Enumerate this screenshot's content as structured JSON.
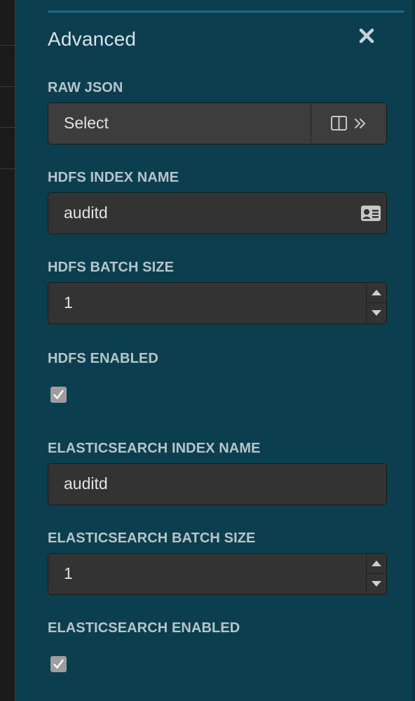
{
  "panel": {
    "title": "Advanced"
  },
  "fields": {
    "raw_json": {
      "label": "RAW JSON",
      "value": "Select"
    },
    "hdfs_index_name": {
      "label": "HDFS INDEX NAME",
      "value": "auditd"
    },
    "hdfs_batch_size": {
      "label": "HDFS BATCH SIZE",
      "value": "1"
    },
    "hdfs_enabled": {
      "label": "HDFS ENABLED",
      "checked": true
    },
    "es_index_name": {
      "label": "ELASTICSEARCH INDEX NAME",
      "value": "auditd"
    },
    "es_batch_size": {
      "label": "ELASTICSEARCH BATCH SIZE",
      "value": "1"
    },
    "es_enabled": {
      "label": "ELASTICSEARCH ENABLED",
      "checked": true
    }
  },
  "icons": {
    "close": "close-icon",
    "split_view": "split-view-icon",
    "expand": "double-chevron-right-icon",
    "contact_card": "contact-card-icon",
    "spinner_up": "caret-up-icon",
    "spinner_down": "caret-down-icon",
    "check": "check-icon"
  },
  "colors": {
    "panel_bg": "#0b3f4f",
    "input_bg": "#333333",
    "label": "#b7c4c9",
    "title": "#d9e2e5",
    "accent_line": "#1a6a82"
  }
}
